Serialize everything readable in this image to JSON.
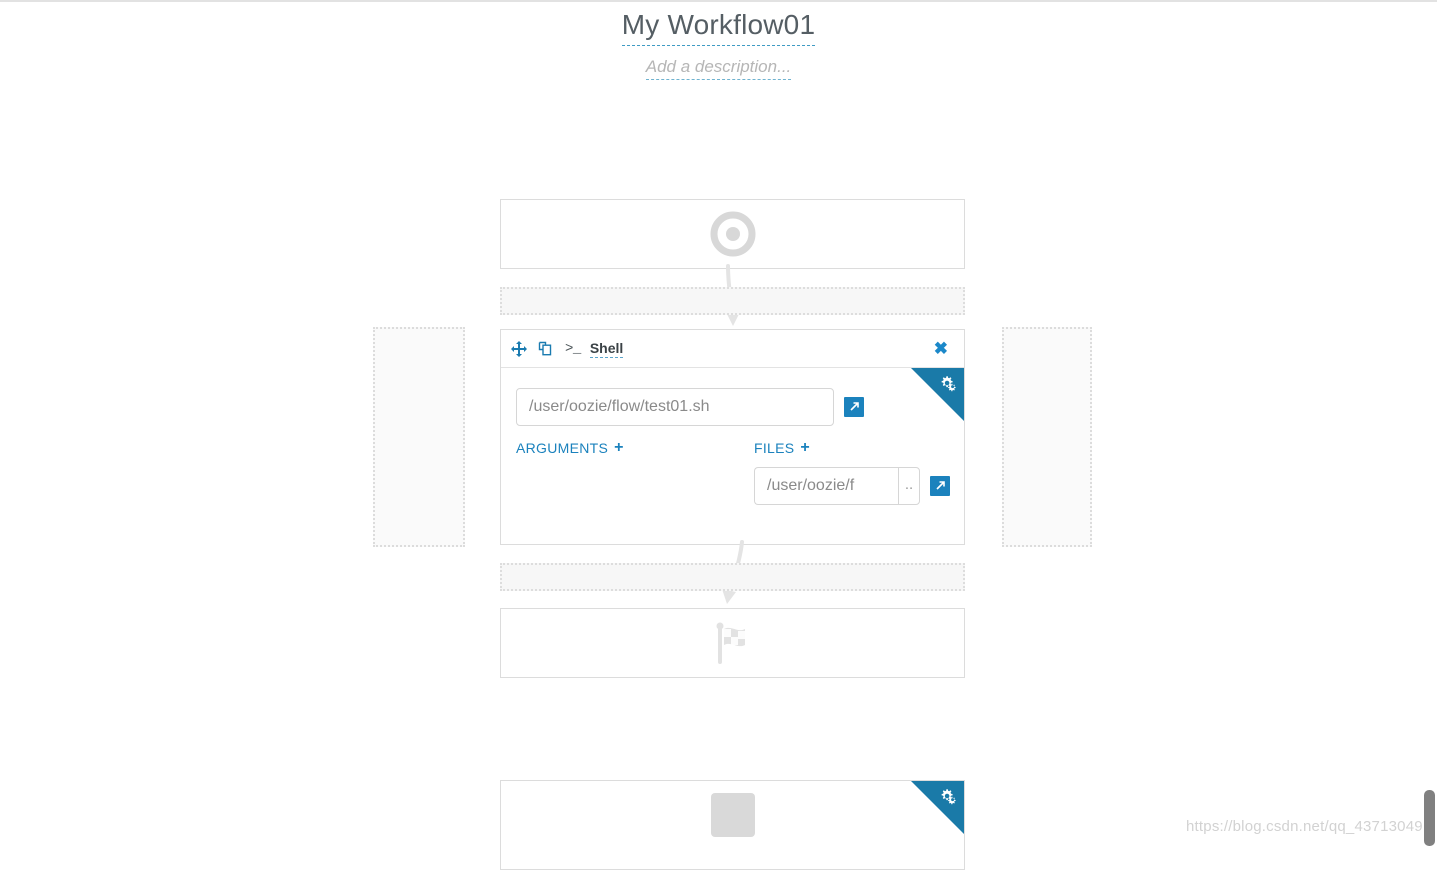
{
  "header": {
    "title": "My Workflow01",
    "description_placeholder": "Add a description..."
  },
  "nodes": {
    "start": {
      "name": "start-node",
      "icon": "target-icon"
    },
    "end": {
      "name": "end-node",
      "icon": "checkered-flag-icon"
    },
    "shell": {
      "label": "Shell",
      "terminal_glyph": ">_",
      "icons": {
        "move": "move-icon",
        "copy": "copy-icon",
        "close": "close-icon",
        "settings": "cogs-icon"
      },
      "script": {
        "value": "/user/oozie/flow/test01.sh",
        "browse_icon": "external-link-icon"
      },
      "arguments": {
        "label": "ARGUMENTS",
        "add": "+"
      },
      "files": {
        "label": "FILES",
        "add": "+",
        "value": "/user/oozie/f",
        "dots_label": "..",
        "browse_icon": "external-link-icon"
      }
    },
    "bottom": {
      "name": "partial-node",
      "icon": "cogs-icon"
    }
  },
  "watermark": "https://blog.csdn.net/qq_43713049",
  "colors": {
    "accent": "#1a7aa8",
    "link": "#1b82bd",
    "title_text": "#555e64",
    "placeholder": "#b6b6b6",
    "node_border": "#dcdcdc",
    "dropzone_bg": "#f7f7f7"
  }
}
